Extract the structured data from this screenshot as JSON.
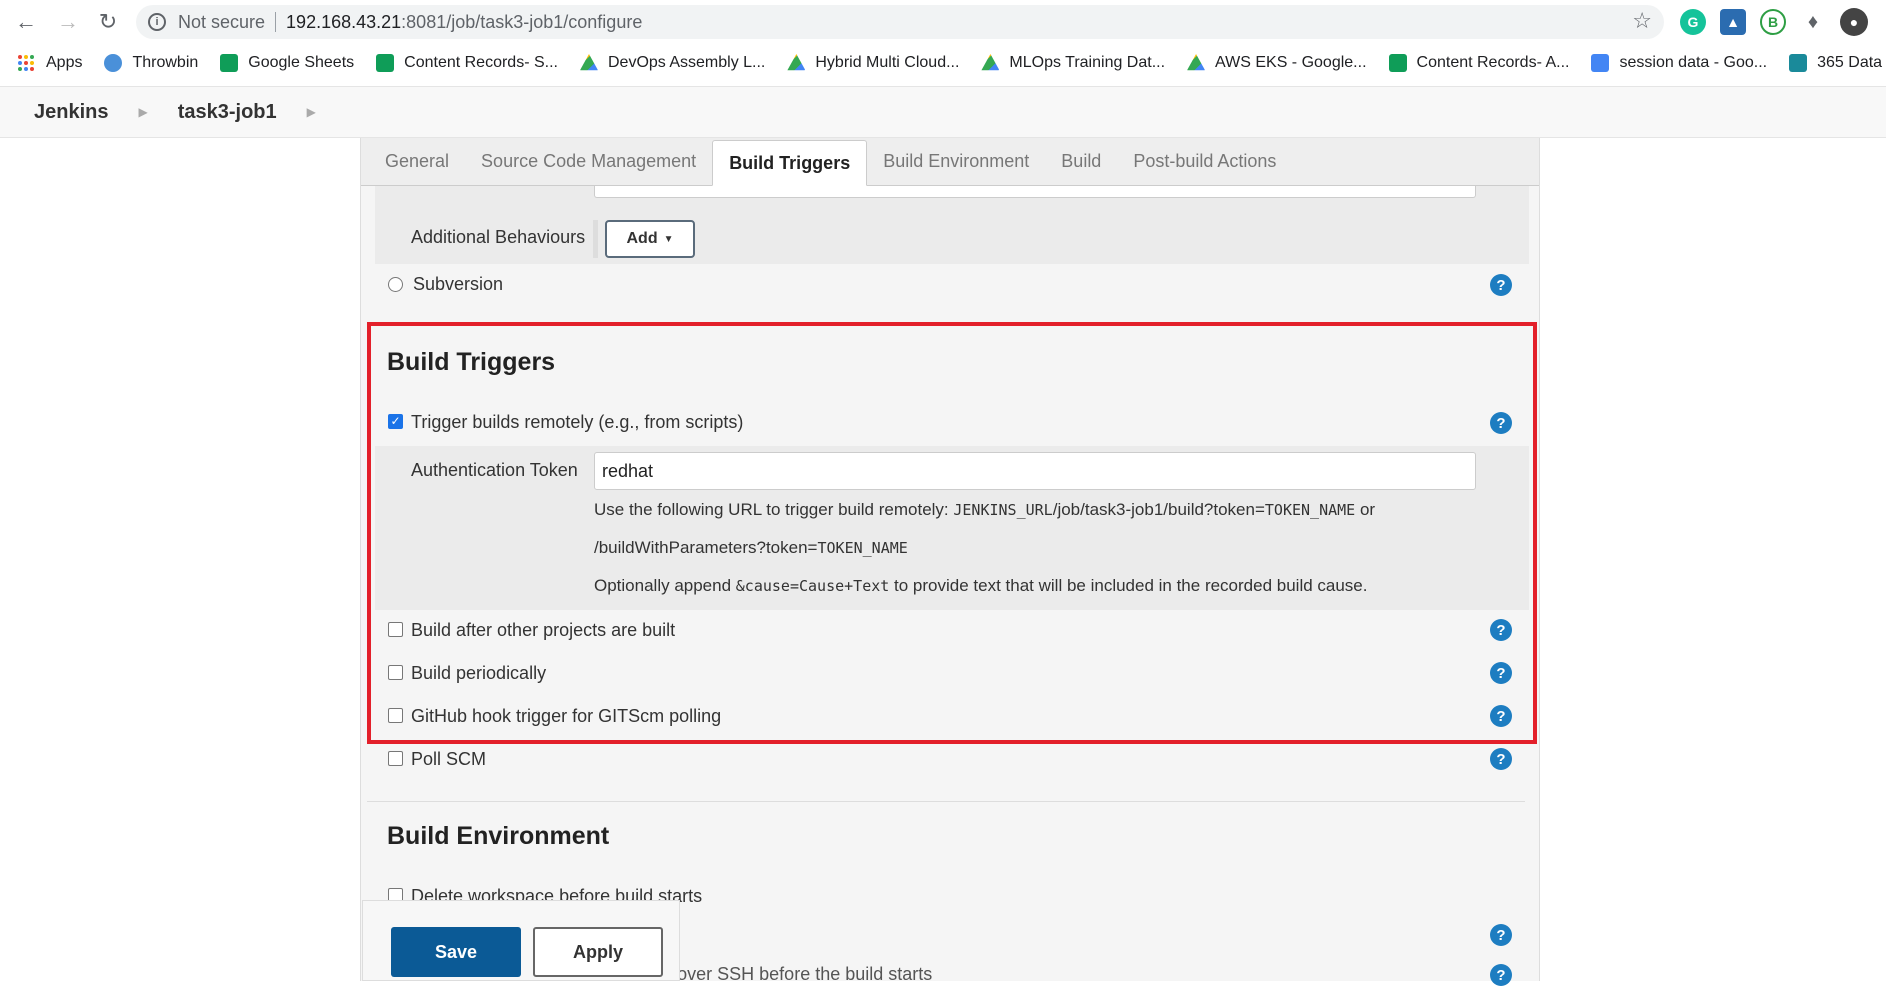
{
  "browser": {
    "not_secure": "Not secure",
    "url_host": "192.168.43.21",
    "url_path": ":8081/job/task3-job1/configure"
  },
  "bookmarks": [
    {
      "label": "Apps",
      "color": "#ea4335"
    },
    {
      "label": "Throwbin",
      "color": "#4a90d9"
    },
    {
      "label": "Google Sheets",
      "color": "#0f9d58"
    },
    {
      "label": "Content Records- S...",
      "color": "#0f9d58"
    },
    {
      "label": "DevOps Assembly L...",
      "color": "#f4b400"
    },
    {
      "label": "Hybrid Multi Cloud...",
      "color": "#f4b400"
    },
    {
      "label": "MLOps Training Dat...",
      "color": "#f4b400"
    },
    {
      "label": "AWS EKS - Google...",
      "color": "#f4b400"
    },
    {
      "label": "Content Records- A...",
      "color": "#0f9d58"
    },
    {
      "label": "session data - Goo...",
      "color": "#4285f4"
    },
    {
      "label": "365 Data Science",
      "color": "#1a8a9a"
    }
  ],
  "jenkins": {
    "home": "Jenkins",
    "job": "task3-job1"
  },
  "tabs": [
    "General",
    "Source Code Management",
    "Build Triggers",
    "Build Environment",
    "Build",
    "Post-build Actions"
  ],
  "scm": {
    "additional_behaviours": "Additional Behaviours",
    "add_label": "Add",
    "subversion": "Subversion"
  },
  "build_triggers": {
    "title": "Build Triggers",
    "trigger_remote": "Trigger builds remotely (e.g., from scripts)",
    "auth_token_label": "Authentication Token",
    "auth_token_value": "redhat",
    "help_line1_a": "Use the following URL to trigger build remotely: ",
    "help_line1_code": "JENKINS_URL",
    "help_line1_b": "/job/task3-job1/build?token=",
    "help_line1_code2": "TOKEN_NAME",
    "help_line1_c": " or",
    "help_line2_a": "/buildWithParameters?token=",
    "help_line2_code": "TOKEN_NAME",
    "help_line3_a": "Optionally append ",
    "help_line3_code": "&cause=Cause+Text",
    "help_line3_b": " to provide text that will be included in the recorded build cause.",
    "build_after": "Build after other projects are built",
    "build_periodically": "Build periodically",
    "github_hook": "GitHub hook trigger for GITScm polling",
    "poll_scm": "Poll SCM"
  },
  "build_environment": {
    "title": "Build Environment",
    "delete_workspace": "Delete workspace before build starts",
    "send_files": "Send files or execute commands over SSH before the build starts"
  },
  "buttons": {
    "save": "Save",
    "apply": "Apply"
  }
}
